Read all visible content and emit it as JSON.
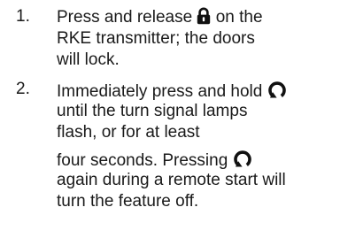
{
  "steps": [
    {
      "number": "1.",
      "lines": [
        {
          "before": "Press and release ",
          "icon": "lock-icon",
          "after": " on the"
        },
        {
          "text": "RKE transmitter; the doors"
        },
        {
          "text": "will lock."
        }
      ]
    },
    {
      "number": "2.",
      "lines": [
        {
          "before": "Immediately press and hold ",
          "icon": "remote-start-icon"
        },
        {
          "text": "until the turn signal lamps"
        },
        {
          "text": "flash, or for at least"
        },
        {
          "text": "four seconds. Pressing ",
          "icon": "remote-start-icon"
        },
        {
          "text": "again during a remote start will"
        },
        {
          "text": "turn the feature off."
        }
      ]
    }
  ]
}
